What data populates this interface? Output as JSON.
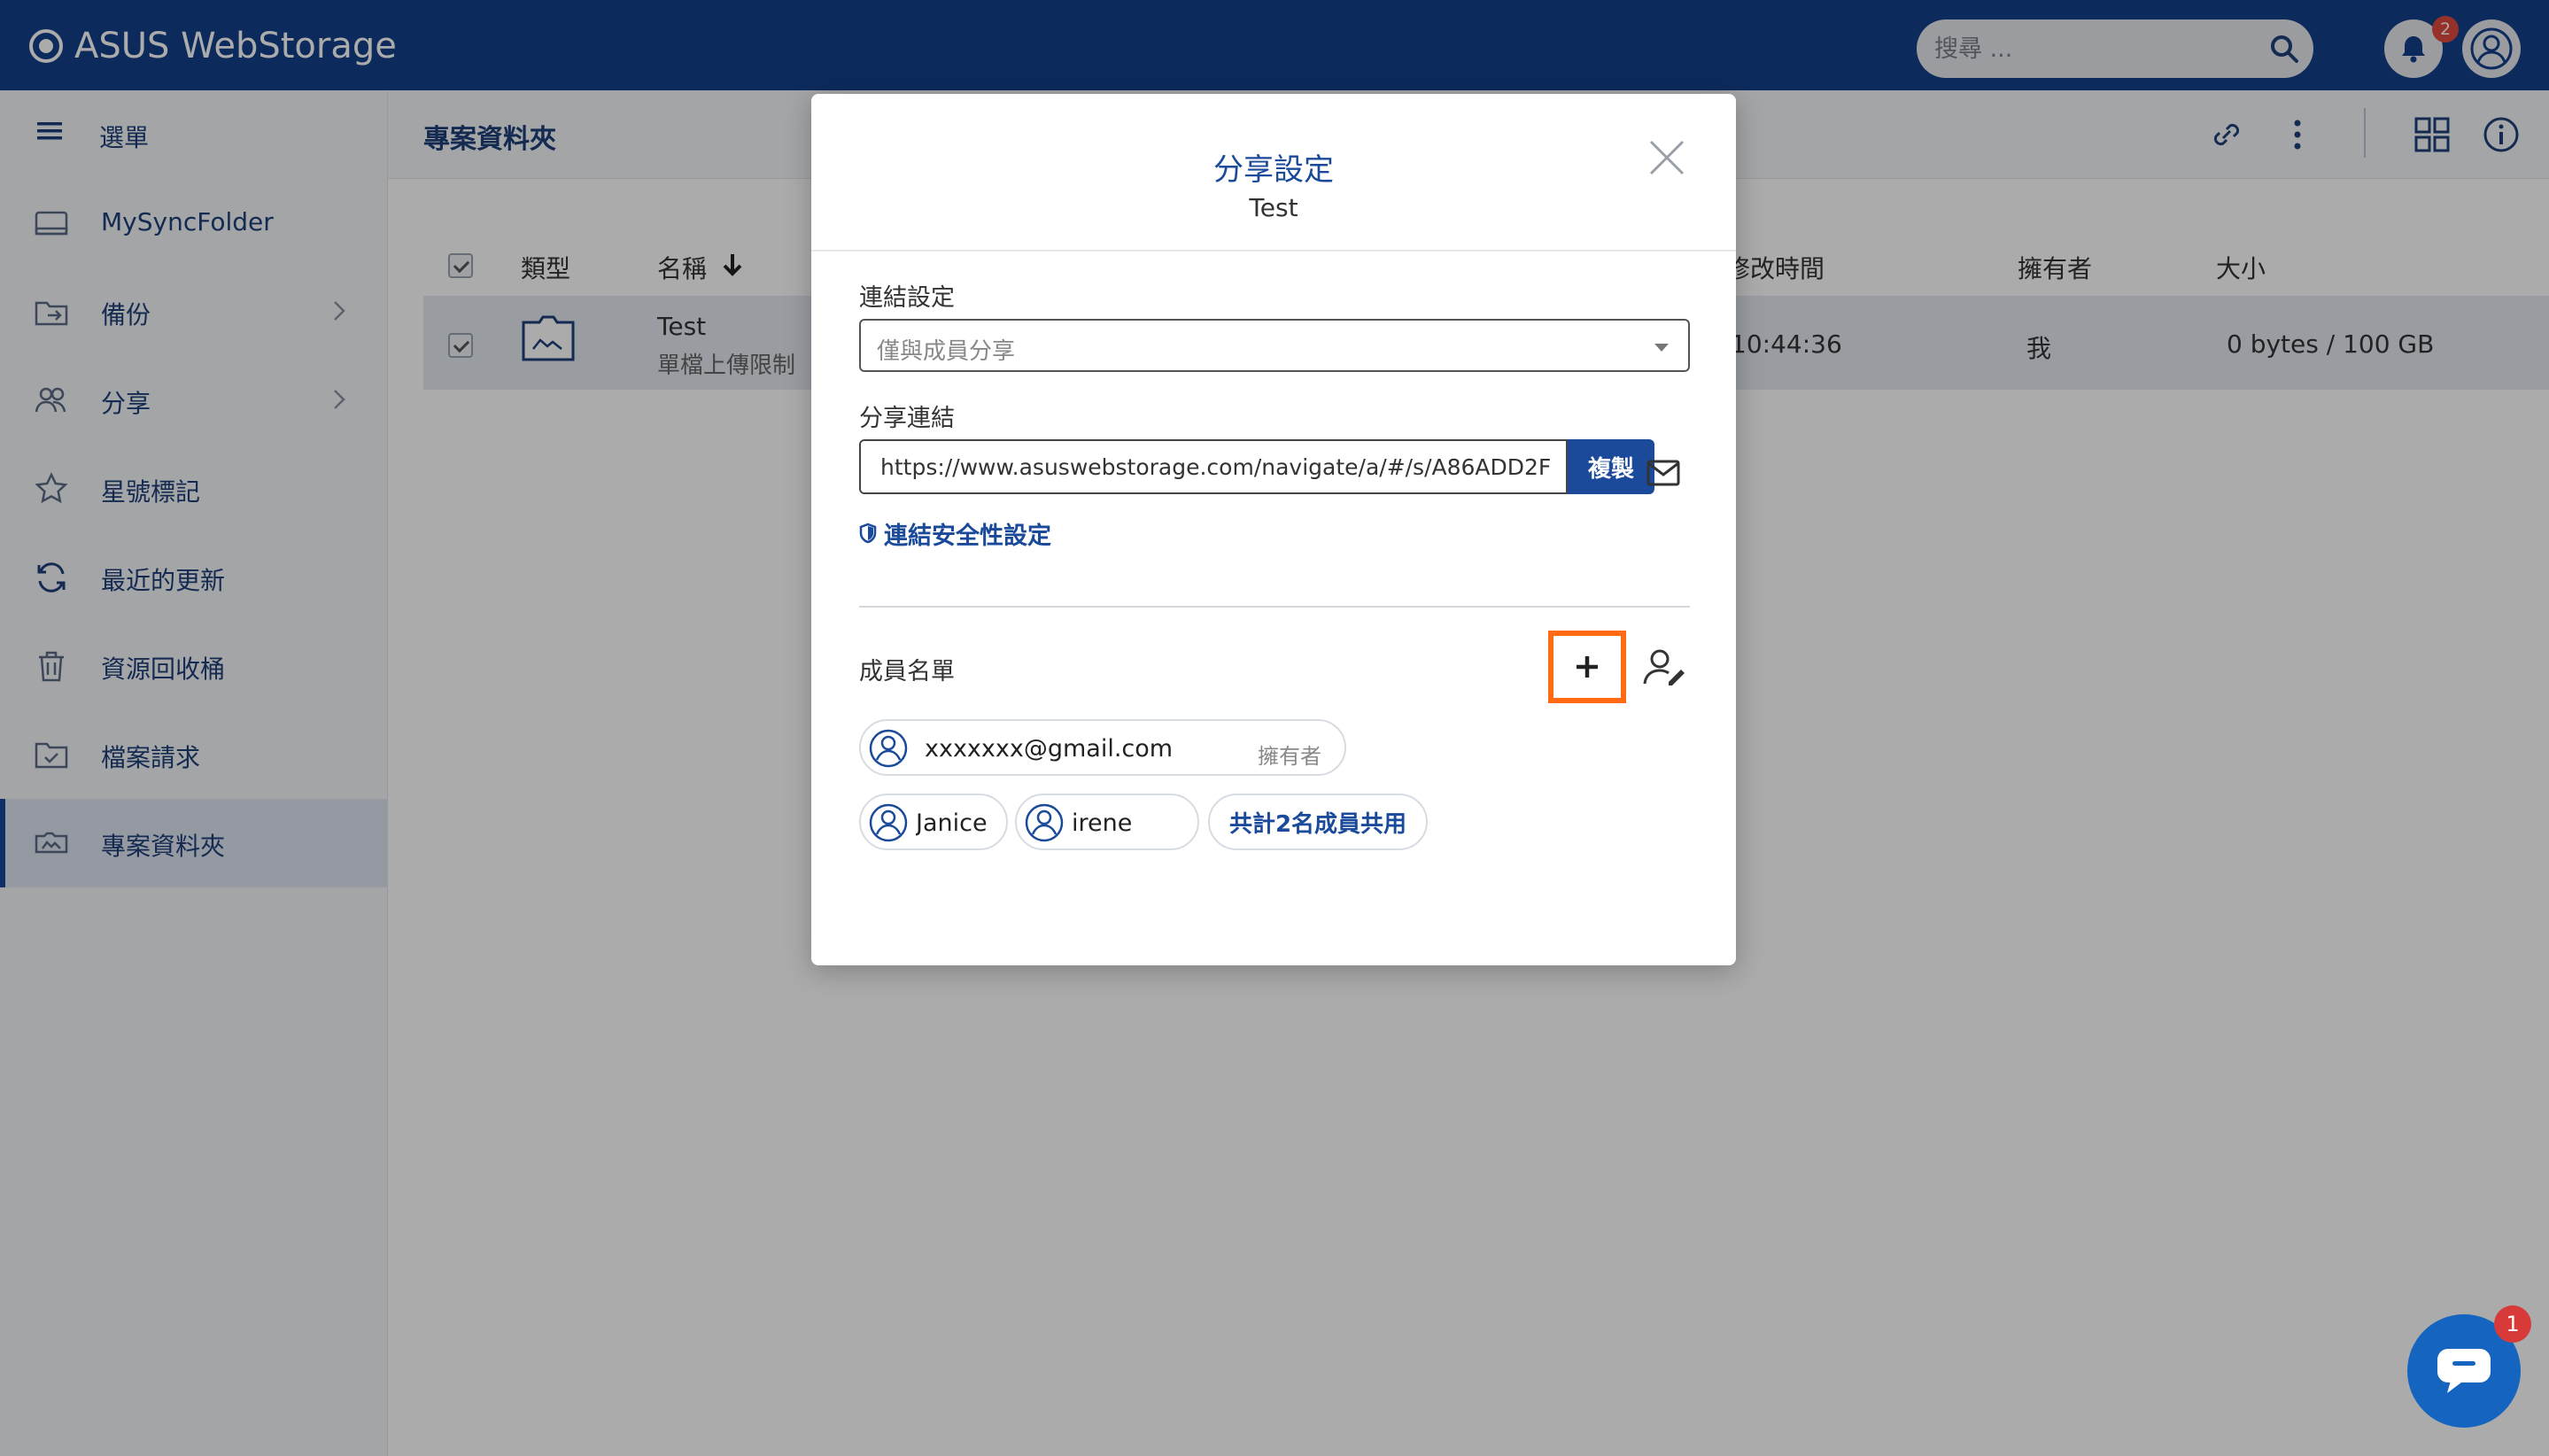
{
  "app": {
    "title": "ASUS WebStorage"
  },
  "search": {
    "placeholder": "搜尋 ..."
  },
  "notifications": {
    "count": "2"
  },
  "sidebar": {
    "menu_label": "選單",
    "items": [
      {
        "label": "MySyncFolder",
        "icon": "sync-folder-icon"
      },
      {
        "label": "備份",
        "icon": "backup-icon"
      },
      {
        "label": "分享",
        "icon": "share-icon"
      },
      {
        "label": "星號標記",
        "icon": "star-icon"
      },
      {
        "label": "最近的更新",
        "icon": "refresh-icon"
      },
      {
        "label": "資源回收桶",
        "icon": "trash-icon"
      },
      {
        "label": "檔案請求",
        "icon": "file-request-icon"
      },
      {
        "label": "專案資料夾",
        "icon": "project-folder-icon"
      }
    ]
  },
  "main": {
    "title": "專案資料夾",
    "columns": {
      "type": "類型",
      "name": "名稱",
      "modified": "修改時間",
      "owner": "擁有者",
      "size": "大小"
    },
    "rows": [
      {
        "name": "Test",
        "subtitle": "單檔上傳限制",
        "modified": "10:44:36",
        "owner": "我",
        "size": "0 bytes / 100 GB"
      }
    ]
  },
  "modal": {
    "title": "分享設定",
    "subtitle": "Test",
    "link_settings_label": "連結設定",
    "link_setting_value": "僅與成員分享",
    "share_link_label": "分享連結",
    "share_link_url": "https://www.asuswebstorage.com/navigate/a/#/s/A86ADD2F",
    "copy_label": "複製",
    "security_link": "連結安全性設定",
    "members_label": "成員名單",
    "members": [
      {
        "name": "xxxxxxx@gmail.com",
        "role": "擁有者"
      },
      {
        "name": "Janice",
        "role": ""
      },
      {
        "name": "irene",
        "role": ""
      }
    ],
    "total_members": "共計2名成員共用"
  },
  "chat": {
    "badge": "1"
  },
  "colors": {
    "primary": "#123f8a",
    "accent": "#1a4a99",
    "highlight": "#ff6a13",
    "badge": "#e04a3f"
  }
}
